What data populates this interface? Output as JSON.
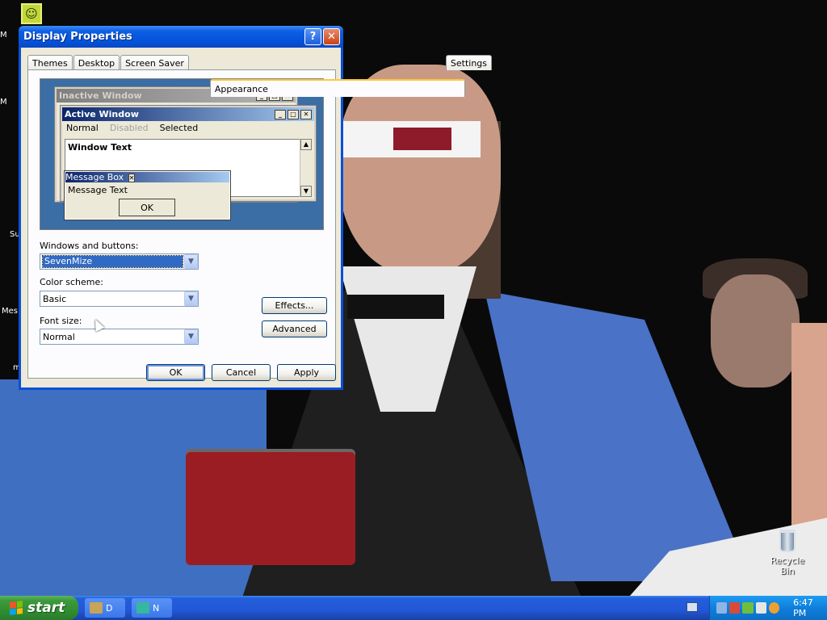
{
  "window": {
    "title": "Display Properties",
    "help_label": "?",
    "close_label": "✕"
  },
  "tabs": [
    "Themes",
    "Desktop",
    "Screen Saver",
    "Appearance",
    "Settings"
  ],
  "preview": {
    "inactive_title": "Inactive Window",
    "active_title": "Active Window",
    "menu_normal": "Normal",
    "menu_disabled": "Disabled",
    "menu_selected": "Selected",
    "window_text": "Window Text",
    "msgbox_title": "Message Box",
    "msgbox_text": "Message Text",
    "msgbox_ok": "OK",
    "min_glyph": "_",
    "max_glyph": "□",
    "close_glyph": "✕"
  },
  "fields": {
    "windows_buttons_label": "Windows and buttons:",
    "windows_buttons_value": "SevenMize",
    "color_scheme_label": "Color scheme:",
    "color_scheme_value": "Basic",
    "font_size_label": "Font size:",
    "font_size_value": "Normal",
    "dropdown_glyph": "▼"
  },
  "buttons": {
    "effects": "Effects...",
    "advanced": "Advanced",
    "ok": "OK",
    "cancel": "Cancel",
    "apply": "Apply"
  },
  "desktop": {
    "edge_labels": [
      "M",
      "M",
      "Su",
      "Mes",
      "m"
    ],
    "recycle_bin": "Recycle Bin"
  },
  "taskbar": {
    "start_label": "start",
    "task1_label": "D",
    "task2_label": "N",
    "clock": "6:47 PM"
  },
  "colors": {
    "titlebar_blue": "#0553d9",
    "dialog_face": "#ece9d8",
    "start_green": "#3c9a3c",
    "taskbar_blue": "#245edb",
    "selection_blue": "#316ac5"
  }
}
